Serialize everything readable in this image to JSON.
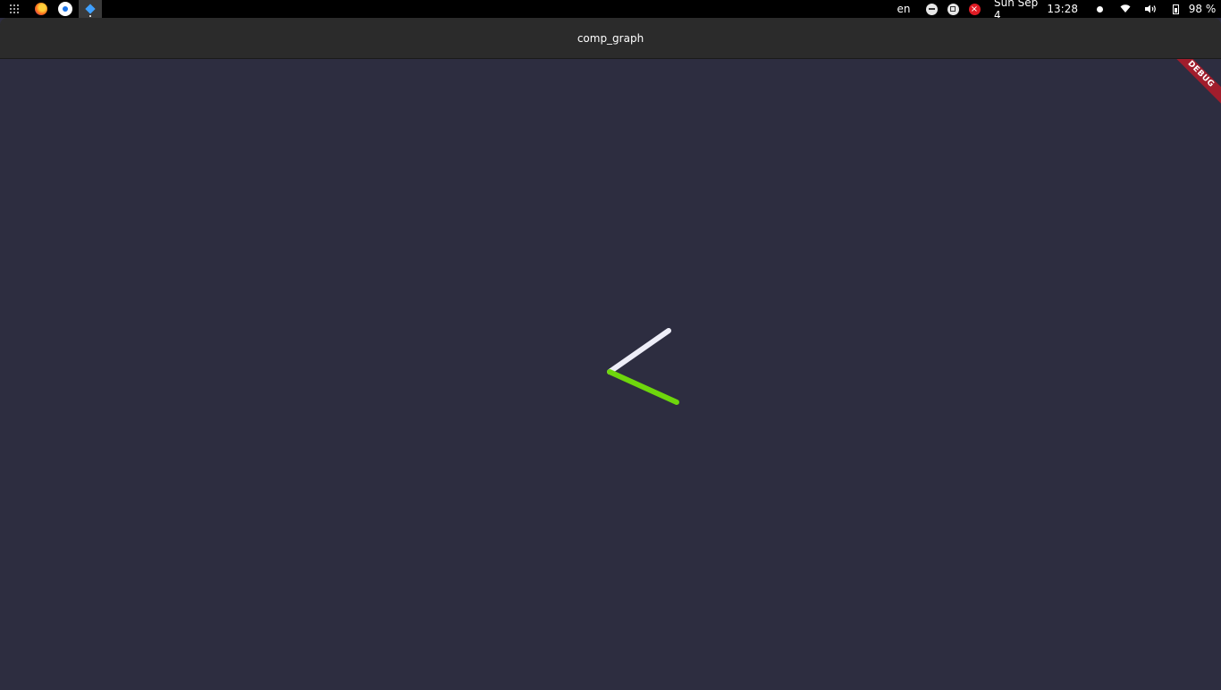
{
  "topbar": {
    "language": "en",
    "date": "Sun Sep 4",
    "time": "13:28",
    "battery_percent": "98 %",
    "dock": [
      "firefox-icon",
      "chrome-icon",
      "flutter-icon"
    ]
  },
  "window": {
    "title": "comp_graph"
  },
  "debug_banner": {
    "label": "DEBUG",
    "color": "#a01d2c"
  },
  "canvas": {
    "background": "#2d2d40",
    "lines": [
      {
        "name": "white-line",
        "color": "#eeeef8"
      },
      {
        "name": "green-line",
        "color": "#6ed60c"
      }
    ]
  }
}
